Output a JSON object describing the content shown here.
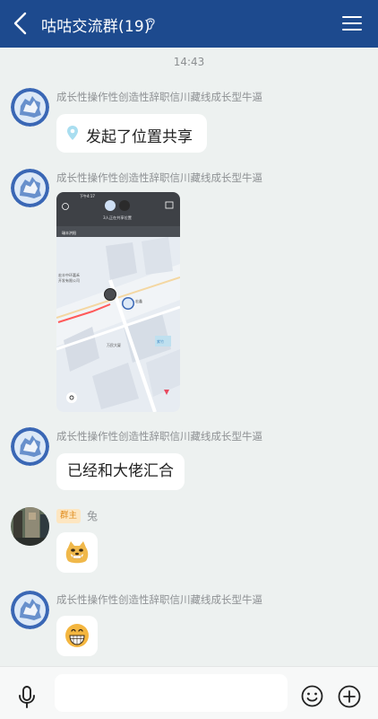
{
  "header": {
    "title": "咕咕交流群(19)"
  },
  "chat": {
    "timestamp": "14:43",
    "messages": [
      {
        "sender": "成长性操作性创造性辞职信川藏线成长型牛逼",
        "location_text": "发起了位置共享"
      },
      {
        "sender": "成长性操作性创造性辞职信川藏线成长型牛逼",
        "map": {
          "status_time": "下午4:17",
          "label": "3人正在共享位置",
          "places": [
            "瑞丰洪阳",
            "紫竹",
            "宏丰中环嘉禾",
            "开发有限公司",
            "宏鑫",
            "万民大厦"
          ]
        }
      },
      {
        "sender": "成长性操作性创造性辞职信川藏线成长型牛逼",
        "text": "已经和大佬汇合"
      },
      {
        "badge": "群主",
        "sender": "兔"
      },
      {
        "sender": "成长性操作性创造性辞职信川藏线成长型牛逼"
      }
    ]
  },
  "colors": {
    "header": "#1d4a8e",
    "background": "#edf1f0",
    "bubble": "#ffffff",
    "badge_bg": "#fde6c1",
    "badge_text": "#e08a1a"
  },
  "icons": [
    "back-arrow-icon",
    "ear-icon",
    "menu-icon",
    "voice-icon",
    "emoji-icon",
    "plus-icon",
    "location-pin-icon"
  ]
}
